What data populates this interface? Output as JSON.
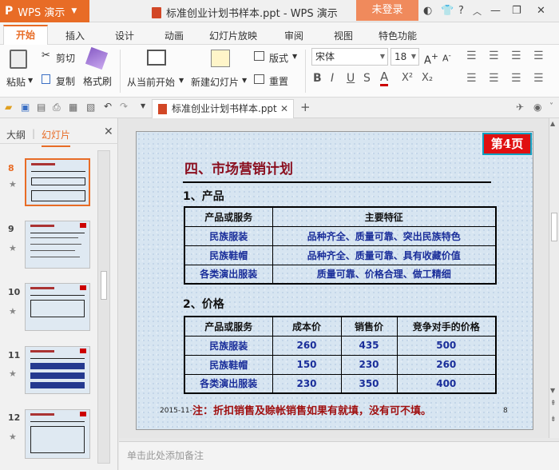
{
  "app": {
    "brand": "WPS 演示",
    "document_title": "标准创业计划书样本.ppt - WPS 演示",
    "login_label": "未登录"
  },
  "menu": {
    "tabs": [
      "开始",
      "插入",
      "设计",
      "动画",
      "幻灯片放映",
      "审阅",
      "视图",
      "特色功能"
    ]
  },
  "ribbon": {
    "paste": "粘贴",
    "cut": "剪切",
    "copy": "复制",
    "format_painter": "格式刷",
    "from_current": "从当前开始",
    "new_slide": "新建幻灯片",
    "layout": "版式",
    "reset": "重置",
    "font_name": "宋体",
    "font_size": "18",
    "format_buttons": [
      "B",
      "I",
      "U",
      "S",
      "A",
      "X²",
      "X₂"
    ]
  },
  "doc_tab": {
    "label": "标准创业计划书样本.ppt"
  },
  "left_panel": {
    "tab_outline": "大纲",
    "tab_slides": "幻灯片",
    "slide_numbers": [
      "8",
      "9",
      "10",
      "11",
      "12"
    ]
  },
  "slide": {
    "page_badge": "第4页",
    "heading": "四、市场营销计划",
    "section1": "1、产品",
    "table1": {
      "headers": [
        "产品或服务",
        "主要特征"
      ],
      "rows": [
        [
          "民族服装",
          "品种齐全、质量可靠、突出民族特色"
        ],
        [
          "民族鞋帽",
          "品种齐全、质量可靠、具有收藏价值"
        ],
        [
          "各类演出服装",
          "质量可靠、价格合理、做工精细"
        ]
      ]
    },
    "section2": "2、价格",
    "table2": {
      "headers": [
        "产品或服务",
        "成本价",
        "销售价",
        "竞争对手的价格"
      ],
      "rows": [
        [
          "民族服装",
          "260",
          "435",
          "500"
        ],
        [
          "民族鞋帽",
          "150",
          "230",
          "260"
        ],
        [
          "各类演出服装",
          "230",
          "350",
          "400"
        ]
      ]
    },
    "footer_date": "2015-11-",
    "footer_note": "注：折扣销售及赊帐销售如果有就填，没有可不填。",
    "footer_page": "8"
  },
  "notes": {
    "placeholder": "单击此处添加备注"
  },
  "colors": {
    "brand": "#e86c26",
    "login": "#f08a5c",
    "heading": "#8b1020",
    "table_body": "#1a2e9a"
  }
}
